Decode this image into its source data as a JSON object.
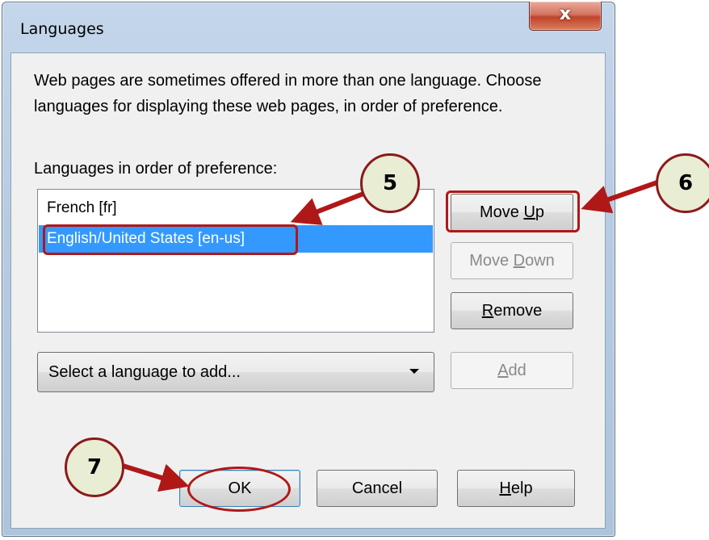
{
  "window": {
    "title": "Languages",
    "close_label": "x"
  },
  "dialog": {
    "description": "Web pages are sometimes offered in more than one language. Choose languages for displaying these web pages, in order of preference.",
    "list_label": "Languages in order of preference:",
    "languages": [
      {
        "label": "French  [fr]",
        "selected": false
      },
      {
        "label": "English/United States  [en-us]",
        "selected": true
      }
    ],
    "buttons": {
      "move_up": {
        "pre": "Move ",
        "key": "U",
        "post": "p"
      },
      "move_down": {
        "pre": "Move ",
        "key": "D",
        "post": "own",
        "disabled": true
      },
      "remove": {
        "pre": "",
        "key": "R",
        "post": "emove"
      },
      "add": {
        "pre": "",
        "key": "A",
        "post": "dd",
        "disabled": true
      },
      "ok": "OK",
      "cancel": "Cancel",
      "help": {
        "pre": "",
        "key": "H",
        "post": "elp"
      }
    },
    "select": {
      "value": "Select a language to add...",
      "icon": "chevron-down-icon"
    }
  },
  "annotations": {
    "callouts": [
      "5",
      "6",
      "7"
    ],
    "color": "#b01818",
    "callout_fill": "#e8edd4"
  },
  "colors": {
    "selection": "#3399ff",
    "window_frame": "#b7cce3",
    "close_button": "#c0432d"
  }
}
